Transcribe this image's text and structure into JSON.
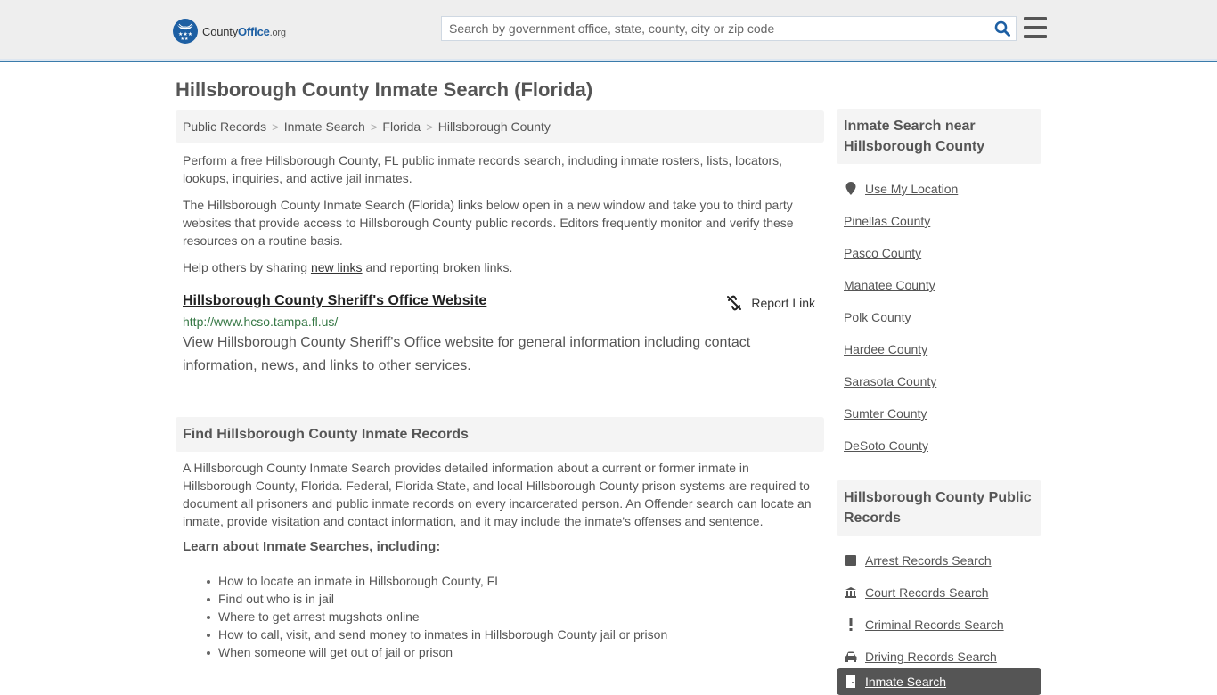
{
  "header": {
    "logo": {
      "main": "County",
      "bold": "Office",
      "tld": ".org"
    },
    "search_placeholder": "Search by government office, state, county, city or zip code",
    "search_icon": "search-icon",
    "menu_icon": "hamburger-menu-icon"
  },
  "page": {
    "title": "Hillsborough County Inmate Search (Florida)",
    "breadcrumb": [
      "Public Records",
      "Inmate Search",
      "Florida",
      "Hillsborough County"
    ],
    "breadcrumb_separator": ">",
    "intro": [
      "Perform a free Hillsborough County, FL public inmate records search, including inmate rosters, lists, locators, lookups, inquiries, and active jail inmates.",
      "The Hillsborough County Inmate Search (Florida) links below open in a new window and take you to third party websites that provide access to Hillsborough County public records. Editors frequently monitor and verify these resources on a routine basis."
    ],
    "help": {
      "before": "Help others by sharing ",
      "link": "new links",
      "after": " and reporting broken links."
    }
  },
  "listing": {
    "title": "Hillsborough County Sheriff's Office Website",
    "url": "http://www.hcso.tampa.fl.us/",
    "description": "View Hillsborough County Sheriff's Office website for general information including contact information, news, and links to other services.",
    "report_label": "Report Link"
  },
  "section": {
    "heading": "Find Hillsborough County Inmate Records",
    "body": "A Hillsborough County Inmate Search provides detailed information about a current or former inmate in Hillsborough County, Florida. Federal, Florida State, and local Hillsborough County prison systems are required to document all prisoners and public inmate records on every incarcerated person. An Offender search can locate an inmate, provide visitation and contact information, and it may include the inmate's offenses and sentence.",
    "learn_heading": "Learn about Inmate Searches, including:",
    "learn_items": [
      "How to locate an inmate in Hillsborough County, FL",
      "Find out who is in jail",
      "Where to get arrest mugshots online",
      "How to call, visit, and send money to inmates in Hillsborough County jail or prison",
      "When someone will get out of jail or prison"
    ]
  },
  "sidebar": {
    "nearby_heading": "Inmate Search near Hillsborough County",
    "use_location": "Use My Location",
    "nearby": [
      "Pinellas County",
      "Pasco County",
      "Manatee County",
      "Polk County",
      "Hardee County",
      "Sarasota County",
      "Sumter County",
      "DeSoto County"
    ],
    "records_heading": "Hillsborough County Public Records",
    "records": [
      {
        "label": "Arrest Records Search",
        "icon": "square-icon"
      },
      {
        "label": "Court Records Search",
        "icon": "courthouse-icon"
      },
      {
        "label": "Criminal Records Search",
        "icon": "exclamation-icon"
      },
      {
        "label": "Driving Records Search",
        "icon": "car-icon"
      }
    ],
    "active_item": {
      "label": "Inmate Search",
      "icon": "door-icon"
    }
  },
  "colors": {
    "brand_blue": "#1d5fa3",
    "header_border": "#3a7bab",
    "url_green": "#357744",
    "active_bg": "#555555"
  }
}
